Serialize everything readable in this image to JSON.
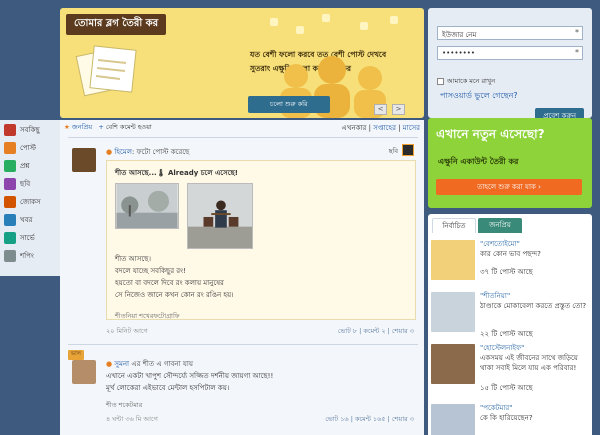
{
  "hero": {
    "title": "তোমার ব্লগ তৈরী কর",
    "line1": "যত বেশী ফলো করবে তত বেশী পোস্ট দেখবে",
    "line2": "সুতরাং এক্ষুনি ফলো করা শুরু কর",
    "cta": "চলো শুরু করি",
    "prev": "<",
    "next": ">"
  },
  "login": {
    "username_placeholder": "ইউজার নেম",
    "password_value": "••••••••",
    "required_mark": "*",
    "remember": "আমাকে মনে রাখুন",
    "forgot": "পাসওয়ার্ড ভুলে গেছেন?",
    "submit": "প্রবেশ করুন"
  },
  "nav": {
    "items": [
      {
        "label": "সবকিছু",
        "icon": "star-icon",
        "color": "#c0392b"
      },
      {
        "label": "পোস্ট",
        "icon": "post-icon",
        "color": "#e67e22"
      },
      {
        "label": "প্রশ্ন",
        "icon": "question-icon",
        "color": "#27ae60"
      },
      {
        "label": "ছবি",
        "icon": "photo-icon",
        "color": "#8e44ad"
      },
      {
        "label": "জোকস",
        "icon": "jokes-icon",
        "color": "#d35400"
      },
      {
        "label": "খবর",
        "icon": "news-icon",
        "color": "#2980b9"
      },
      {
        "label": "সার্ভে",
        "icon": "survey-icon",
        "color": "#16a085"
      },
      {
        "label": "শপিং",
        "icon": "shopping-icon",
        "color": "#7f8c8d"
      }
    ]
  },
  "feed": {
    "tab_popular": "জনপ্রিয়",
    "tab_comments": "বেশি কমেন্ট হওয়া",
    "time_now": "এখনকার",
    "time_week": "সপ্তাহের",
    "time_month": "মাসের",
    "posts": [
      {
        "user": "হিমেল",
        "action": "ফটো পোস্ট করেছে",
        "category": "ছবি",
        "inner_title": "শীত আসছে...🌡 Already চলে এসেছে!",
        "lines": [
          "শীত আসছে।",
          "বদলে যাচ্ছে সবকিছুর রং!",
          "হয়তো বা বদলে দিবে রং কলায় মানুষের",
          "সে নিজেও জানে কখন কোন রং রঙিন হয়।"
        ],
        "tags": "শীতনিয়া  শখেরফটোগ্রাফি",
        "time": "২০ মিনিট আগে",
        "likes": "ভোট ৮",
        "comments": "কমেন্ট ২",
        "shares": "শেয়ার ৩"
      },
      {
        "badge": "ভাল",
        "user": "সুমনা",
        "action": "এর শীত এ গাবনা যায়",
        "line1": "এখানে একটা খাপুশ সৌন্দর্য্যে সজ্জিত দর্শনীয় জায়গা আছে!!",
        "line2": "মূর্খ লোকেরা এইভাবে মেন্টাল হসপিটাল কয়।",
        "tags": "শীত  শকেটমার",
        "time": "৪ ঘন্টা ৩৬ মি আগে",
        "likes": "ভোট ১৬",
        "comments": "কমেন্ট ১৬৫",
        "shares": "শেয়ার ৩"
      }
    ]
  },
  "ad": {
    "headline": "এখানে নতুন এসেছো?",
    "sub": "এক্ষুনি একাউন্ট তৈরী কর",
    "cta": "তাহলে শুরু করা যাক"
  },
  "side": {
    "tab_selected": "নির্বাচিত",
    "tab_popular": "জনপ্রিয়",
    "items": [
      {
        "title": "\"বেশতোইমো\"",
        "sub": "কার কোন ভাব পছন্দ?",
        "count": "৩৭ টি পোস্ট আছে",
        "thumb": "#f2d07a"
      },
      {
        "title": "\"শীতনিয়া\"",
        "sub": "ঠাণ্ডাকে মোকাবেলা করতে প্রস্তুত তো?",
        "count": "২২ টি পোস্ট আছে",
        "thumb": "#c9d3dc"
      },
      {
        "title": "\"হোস্টেলনাইফ\"",
        "sub": "একসময় এই জীবনের সাথে জড়িয়ে থাকা সবাই মিলে যায় এক পরিবার!",
        "count": "১৫ টি পোস্ট আছে",
        "thumb": "#8a6a4a"
      },
      {
        "title": "\"পকেটমার\"",
        "sub": "কে কি হারিয়েছেন?",
        "count": "",
        "thumb": "#b7c4d4"
      }
    ]
  }
}
